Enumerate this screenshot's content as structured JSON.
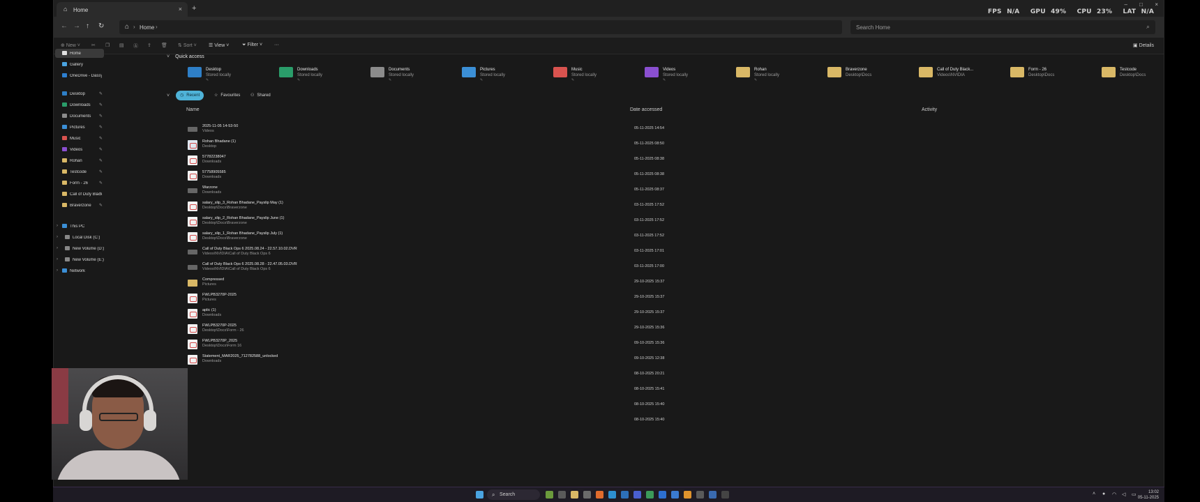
{
  "window": {
    "tab_title": "Home",
    "tab_close": "×",
    "new_tab": "+",
    "minimize": "–",
    "maximize": "□",
    "close": "×"
  },
  "overlay": {
    "fps_label": "FPS",
    "fps_value": "N/A",
    "gpu_label": "GPU",
    "gpu_value": "49%",
    "cpu_label": "CPU",
    "cpu_value": "23%",
    "lat_label": "LAT",
    "lat_value": "N/A"
  },
  "address": {
    "crumb": "Home",
    "search_placeholder": "Search Home"
  },
  "commands": {
    "new": "New",
    "sort": "Sort",
    "view": "View",
    "filter": "Filter",
    "more": "···",
    "details": "Details"
  },
  "sidebar": {
    "top": [
      {
        "label": "Home",
        "icon": "home-icon",
        "color": "#e0e0e0",
        "selected": true
      },
      {
        "label": "Gallery",
        "icon": "gallery-icon",
        "color": "#4aa3e0"
      },
      {
        "label": "OneDrive - Dassynic",
        "icon": "cloud-icon",
        "color": "#2d7fd0"
      }
    ],
    "pinned": [
      {
        "label": "Desktop",
        "color": "#2e7fc7"
      },
      {
        "label": "Downloads",
        "color": "#2a9d6a"
      },
      {
        "label": "Documents",
        "color": "#8b8b8b"
      },
      {
        "label": "Pictures",
        "color": "#3b8fd6",
        "hover": true
      },
      {
        "label": "Music",
        "color": "#d9534f"
      },
      {
        "label": "Videos",
        "color": "#8a4fd0"
      },
      {
        "label": "Rohan",
        "color": "#d9b866"
      },
      {
        "label": "Testcode",
        "color": "#d9b866"
      },
      {
        "label": "Form - 26",
        "color": "#d9b866"
      },
      {
        "label": "Call of Duty Black O",
        "color": "#d9b866"
      },
      {
        "label": "Braverzone",
        "color": "#d9b866"
      }
    ],
    "tree": [
      {
        "label": "This PC",
        "color": "#3b8fd6"
      },
      {
        "label": "Local Disk (C:)",
        "color": "#888"
      },
      {
        "label": "New Volume (D:)",
        "color": "#888"
      },
      {
        "label": "New Volume (E:)",
        "color": "#888"
      },
      {
        "label": "Network",
        "color": "#3b8fd6"
      }
    ]
  },
  "quick_access": {
    "title": "Quick access",
    "items": [
      {
        "name": "Desktop",
        "sub": "Stored locally",
        "color": "#2e7fc7",
        "pinned": true
      },
      {
        "name": "Downloads",
        "sub": "Stored locally",
        "color": "#2a9d6a",
        "pinned": true
      },
      {
        "name": "Documents",
        "sub": "Stored locally",
        "color": "#8b8b8b",
        "pinned": true
      },
      {
        "name": "Pictures",
        "sub": "Stored locally",
        "color": "#3b8fd6",
        "pinned": true
      },
      {
        "name": "Music",
        "sub": "Stored locally",
        "color": "#d9534f",
        "pinned": true
      },
      {
        "name": "Videos",
        "sub": "Stored locally",
        "color": "#8a4fd0",
        "pinned": true
      },
      {
        "name": "Rohan",
        "sub": "Stored locally",
        "color": "#d9b866",
        "pinned": true
      },
      {
        "name": "Braverzone",
        "sub": "Desktop\\Docs",
        "color": "#d9b866",
        "pinned": false
      },
      {
        "name": "Call of Duty Black...",
        "sub": "Videos\\NVIDIA",
        "color": "#d9b866",
        "pinned": false
      },
      {
        "name": "Form - 26",
        "sub": "Desktop\\Docs",
        "color": "#d9b866",
        "pinned": false
      },
      {
        "name": "Testcode",
        "sub": "Desktop\\Docs",
        "color": "#d9b866",
        "pinned": false
      }
    ]
  },
  "filters": {
    "recent": "Recent",
    "favourites": "Favourites",
    "shared": "Shared"
  },
  "columns": {
    "name": "Name",
    "date": "Date accessed",
    "activity": "Activity"
  },
  "files": [
    {
      "name": "2025-11-05 14-53-50",
      "location": "Videos",
      "date": "05-11-2025 14:54",
      "type": "video"
    },
    {
      "name": "Rohan Bhadane (1)",
      "location": "Desktop",
      "date": "05-11-2025 08:50",
      "type": "doc"
    },
    {
      "name": "57782238047",
      "location": "Downloads",
      "date": "05-11-2025 08:38",
      "type": "pdf"
    },
    {
      "name": "57758905585",
      "location": "Downloads",
      "date": "05-11-2025 08:38",
      "type": "pdf"
    },
    {
      "name": "Warzone",
      "location": "Downloads",
      "date": "05-11-2025 08:37",
      "type": "video"
    },
    {
      "name": "salary_slip_3_Rohan Bhadane_Payslip May (1)",
      "location": "Desktop\\Docs\\Braverzone",
      "date": "03-11-2025 17:52",
      "type": "pdf"
    },
    {
      "name": "salary_slip_2_Rohan Bhadane_Payslip June (1)",
      "location": "Desktop\\Docs\\Braverzone",
      "date": "03-11-2025 17:52",
      "type": "pdf"
    },
    {
      "name": "salary_slip_1_Rohan Bhadane_Payslip July (1)",
      "location": "Desktop\\Docs\\Braverzone",
      "date": "03-11-2025 17:52",
      "type": "pdf"
    },
    {
      "name": "Call of Duty  Black Ops 6 2025.08.24 - 22.57.10.02.DVR",
      "location": "Videos\\NVIDIA\\Call of Duty  Black Ops 6",
      "date": "03-11-2025 17:01",
      "type": "video"
    },
    {
      "name": "Call of Duty  Black Ops 6 2025.08.28 - 22.47.05.03.DVR",
      "location": "Videos\\NVIDIA\\Call of Duty  Black Ops 6",
      "date": "03-11-2025 17:00",
      "type": "video"
    },
    {
      "name": "Compressed",
      "location": "Pictures",
      "date": "29-10-2025 15:37",
      "type": "folder"
    },
    {
      "name": "FWLPB3270P-2025",
      "location": "Pictures",
      "date": "29-10-2025 15:37",
      "type": "pdf"
    },
    {
      "name": "aplic (1)",
      "location": "Downloads",
      "date": "29-10-2025 15:37",
      "type": "pdf"
    },
    {
      "name": "FWLPB3270P-2025",
      "location": "Desktop\\Docs\\Form - 26",
      "date": "29-10-2025 15:36",
      "type": "pdf"
    },
    {
      "name": "FWLPB3270P_2025",
      "location": "Desktop\\Docs\\Form 16",
      "date": "09-10-2025 15:36",
      "type": "pdf"
    },
    {
      "name": "Statement_MAR2025_712782588_unlocked",
      "location": "Downloads",
      "date": "09-10-2025 12:38",
      "type": "pdf"
    },
    {
      "name": "",
      "location": "",
      "date": "08-10-2025 20:21",
      "type": "none"
    },
    {
      "name": "",
      "location": "",
      "date": "08-10-2025 15:41",
      "type": "none"
    },
    {
      "name": "",
      "location": "",
      "date": "08-10-2025 15:40",
      "type": "none"
    },
    {
      "name": "",
      "location": "",
      "date": "08-10-2025 15:40",
      "type": "none"
    }
  ],
  "taskbar": {
    "search": "Search",
    "time": "13:02",
    "date": "05-11-2025"
  }
}
